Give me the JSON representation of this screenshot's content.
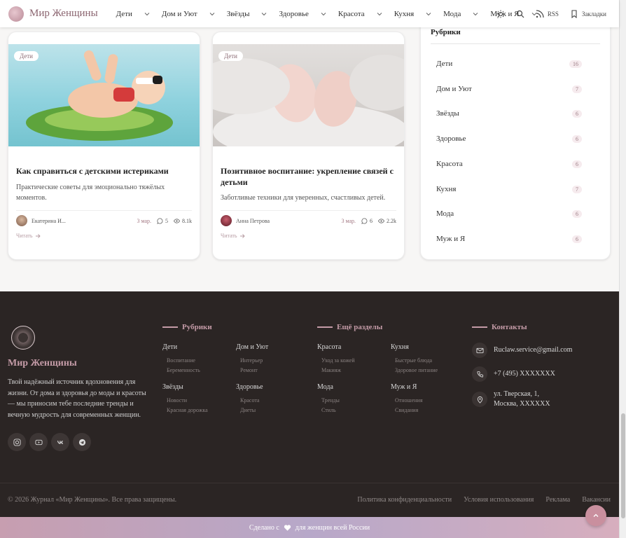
{
  "header": {
    "logo_text": "Мир Женщины",
    "nav": [
      "Дети",
      "Дом и Уют",
      "Звёзды",
      "Здоровье",
      "Красота",
      "Кухня",
      "Мода",
      "Муж и Я"
    ],
    "rss_label": "RSS",
    "bookmarks_label": "Закладки"
  },
  "cards": [
    {
      "badge": "Дети",
      "title": "Как справиться с детскими истериками",
      "description": "Практические советы для эмоционально тяжёлых моментов.",
      "author": "Екатерина И...",
      "date": "3 мар.",
      "comments": "5",
      "views": "8.1k",
      "read_label": "Читать"
    },
    {
      "badge": "Дети",
      "title": "Позитивное воспитание: укрепление связей с детьми",
      "description": "Заботливые техники для уверенных, счастливых детей.",
      "author": "Анна Петрова",
      "date": "3 мар.",
      "comments": "6",
      "views": "2.2k",
      "read_label": "Читать"
    }
  ],
  "sidebar": {
    "title": "Рубрики",
    "items": [
      {
        "label": "Дети",
        "count": "16"
      },
      {
        "label": "Дом и Уют",
        "count": "7"
      },
      {
        "label": "Звёзды",
        "count": "6"
      },
      {
        "label": "Здоровье",
        "count": "6"
      },
      {
        "label": "Красота",
        "count": "6"
      },
      {
        "label": "Кухня",
        "count": "7"
      },
      {
        "label": "Мода",
        "count": "6"
      },
      {
        "label": "Муж и Я",
        "count": "6"
      }
    ]
  },
  "footer": {
    "brand": "Мир Женщины",
    "description": "Твой надёжный источник вдохновения для жизни. От дома и здоровья до моды и красоты — мы приносим тебе последние тренды и вечную мудрость для современных женщин.",
    "rubrics_title": "Рубрики",
    "more_title": "Ещё разделы",
    "contacts_title": "Контакты",
    "rubrics": [
      {
        "label": "Дети",
        "subs": [
          "Воспитание",
          "Беременность"
        ]
      },
      {
        "label": "Дом и Уют",
        "subs": [
          "Интерьер",
          "Ремонт"
        ]
      },
      {
        "label": "Звёзды",
        "subs": [
          "Новости",
          "Красная дорожка"
        ]
      },
      {
        "label": "Здоровье",
        "subs": [
          "Красота",
          "Диеты"
        ]
      }
    ],
    "more": [
      {
        "label": "Красота",
        "subs": [
          "Уход за кожей",
          "Макияж"
        ]
      },
      {
        "label": "Кухня",
        "subs": [
          "Быстрые блюда",
          "Здоровое питание"
        ]
      },
      {
        "label": "Мода",
        "subs": [
          "Тренды",
          "Стиль"
        ]
      },
      {
        "label": "Муж и Я",
        "subs": [
          "Отношения",
          "Свидания"
        ]
      }
    ],
    "contacts": {
      "email": "Ruclaw.service@gmail.com",
      "phone": "+7 (495) XXXXXXX",
      "address_line1": "ул. Тверская, 1,",
      "address_line2": "Москва, XXXXXX"
    },
    "copyright": "© 2026 Журнал «Мир Женщины». Все права защищены.",
    "links": [
      "Политика конфиденциальности",
      "Условия использования",
      "Реклама",
      "Вакансии"
    ]
  },
  "bottom_bar": {
    "left": "Сделано с",
    "right": "для женщин всей России"
  },
  "colors": {
    "brand": "#c49ba7",
    "footer_bg": "#2b2524",
    "accent": "#c98f9e"
  }
}
